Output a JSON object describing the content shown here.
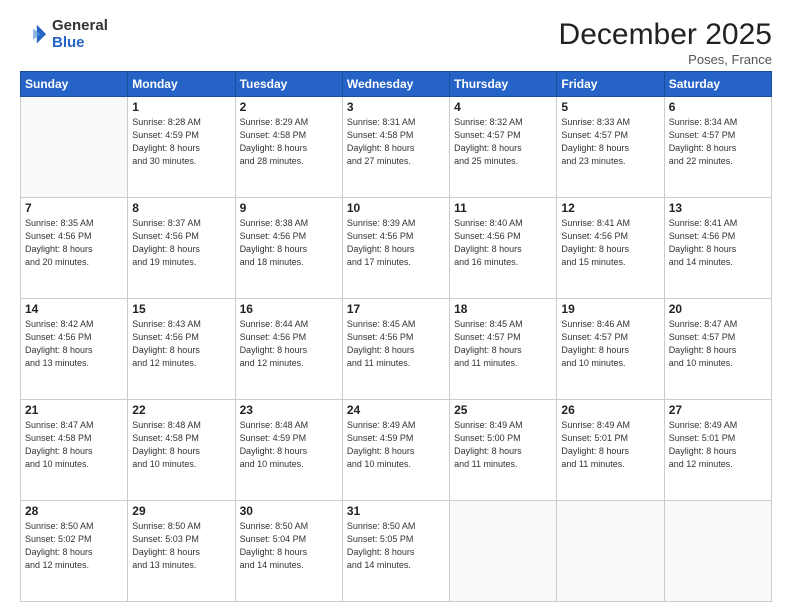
{
  "logo": {
    "general": "General",
    "blue": "Blue"
  },
  "header": {
    "month": "December 2025",
    "location": "Poses, France"
  },
  "days_header": [
    "Sunday",
    "Monday",
    "Tuesday",
    "Wednesday",
    "Thursday",
    "Friday",
    "Saturday"
  ],
  "weeks": [
    [
      {
        "num": "",
        "info": ""
      },
      {
        "num": "1",
        "info": "Sunrise: 8:28 AM\nSunset: 4:59 PM\nDaylight: 8 hours\nand 30 minutes."
      },
      {
        "num": "2",
        "info": "Sunrise: 8:29 AM\nSunset: 4:58 PM\nDaylight: 8 hours\nand 28 minutes."
      },
      {
        "num": "3",
        "info": "Sunrise: 8:31 AM\nSunset: 4:58 PM\nDaylight: 8 hours\nand 27 minutes."
      },
      {
        "num": "4",
        "info": "Sunrise: 8:32 AM\nSunset: 4:57 PM\nDaylight: 8 hours\nand 25 minutes."
      },
      {
        "num": "5",
        "info": "Sunrise: 8:33 AM\nSunset: 4:57 PM\nDaylight: 8 hours\nand 23 minutes."
      },
      {
        "num": "6",
        "info": "Sunrise: 8:34 AM\nSunset: 4:57 PM\nDaylight: 8 hours\nand 22 minutes."
      }
    ],
    [
      {
        "num": "7",
        "info": "Sunrise: 8:35 AM\nSunset: 4:56 PM\nDaylight: 8 hours\nand 20 minutes."
      },
      {
        "num": "8",
        "info": "Sunrise: 8:37 AM\nSunset: 4:56 PM\nDaylight: 8 hours\nand 19 minutes."
      },
      {
        "num": "9",
        "info": "Sunrise: 8:38 AM\nSunset: 4:56 PM\nDaylight: 8 hours\nand 18 minutes."
      },
      {
        "num": "10",
        "info": "Sunrise: 8:39 AM\nSunset: 4:56 PM\nDaylight: 8 hours\nand 17 minutes."
      },
      {
        "num": "11",
        "info": "Sunrise: 8:40 AM\nSunset: 4:56 PM\nDaylight: 8 hours\nand 16 minutes."
      },
      {
        "num": "12",
        "info": "Sunrise: 8:41 AM\nSunset: 4:56 PM\nDaylight: 8 hours\nand 15 minutes."
      },
      {
        "num": "13",
        "info": "Sunrise: 8:41 AM\nSunset: 4:56 PM\nDaylight: 8 hours\nand 14 minutes."
      }
    ],
    [
      {
        "num": "14",
        "info": "Sunrise: 8:42 AM\nSunset: 4:56 PM\nDaylight: 8 hours\nand 13 minutes."
      },
      {
        "num": "15",
        "info": "Sunrise: 8:43 AM\nSunset: 4:56 PM\nDaylight: 8 hours\nand 12 minutes."
      },
      {
        "num": "16",
        "info": "Sunrise: 8:44 AM\nSunset: 4:56 PM\nDaylight: 8 hours\nand 12 minutes."
      },
      {
        "num": "17",
        "info": "Sunrise: 8:45 AM\nSunset: 4:56 PM\nDaylight: 8 hours\nand 11 minutes."
      },
      {
        "num": "18",
        "info": "Sunrise: 8:45 AM\nSunset: 4:57 PM\nDaylight: 8 hours\nand 11 minutes."
      },
      {
        "num": "19",
        "info": "Sunrise: 8:46 AM\nSunset: 4:57 PM\nDaylight: 8 hours\nand 10 minutes."
      },
      {
        "num": "20",
        "info": "Sunrise: 8:47 AM\nSunset: 4:57 PM\nDaylight: 8 hours\nand 10 minutes."
      }
    ],
    [
      {
        "num": "21",
        "info": "Sunrise: 8:47 AM\nSunset: 4:58 PM\nDaylight: 8 hours\nand 10 minutes."
      },
      {
        "num": "22",
        "info": "Sunrise: 8:48 AM\nSunset: 4:58 PM\nDaylight: 8 hours\nand 10 minutes."
      },
      {
        "num": "23",
        "info": "Sunrise: 8:48 AM\nSunset: 4:59 PM\nDaylight: 8 hours\nand 10 minutes."
      },
      {
        "num": "24",
        "info": "Sunrise: 8:49 AM\nSunset: 4:59 PM\nDaylight: 8 hours\nand 10 minutes."
      },
      {
        "num": "25",
        "info": "Sunrise: 8:49 AM\nSunset: 5:00 PM\nDaylight: 8 hours\nand 11 minutes."
      },
      {
        "num": "26",
        "info": "Sunrise: 8:49 AM\nSunset: 5:01 PM\nDaylight: 8 hours\nand 11 minutes."
      },
      {
        "num": "27",
        "info": "Sunrise: 8:49 AM\nSunset: 5:01 PM\nDaylight: 8 hours\nand 12 minutes."
      }
    ],
    [
      {
        "num": "28",
        "info": "Sunrise: 8:50 AM\nSunset: 5:02 PM\nDaylight: 8 hours\nand 12 minutes."
      },
      {
        "num": "29",
        "info": "Sunrise: 8:50 AM\nSunset: 5:03 PM\nDaylight: 8 hours\nand 13 minutes."
      },
      {
        "num": "30",
        "info": "Sunrise: 8:50 AM\nSunset: 5:04 PM\nDaylight: 8 hours\nand 14 minutes."
      },
      {
        "num": "31",
        "info": "Sunrise: 8:50 AM\nSunset: 5:05 PM\nDaylight: 8 hours\nand 14 minutes."
      },
      {
        "num": "",
        "info": ""
      },
      {
        "num": "",
        "info": ""
      },
      {
        "num": "",
        "info": ""
      }
    ]
  ]
}
